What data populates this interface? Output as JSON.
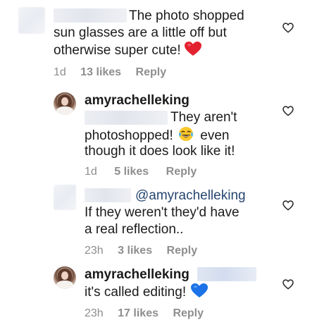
{
  "comments": [
    {
      "text_line1": "The photo shopped",
      "text_line2": "sun glasses are a little off but",
      "text_line3": "otherwise super cute!",
      "emoji": "red-heart-emoji",
      "time": "1d",
      "likes": "13 likes",
      "reply": "Reply"
    },
    {
      "username": "amyrachelleking",
      "text_line1": "They aren't",
      "text_line2a": "photoshopped!",
      "emoji": "tears-of-joy-emoji",
      "text_line2b": "even",
      "text_line3": "though it does look like it!",
      "time": "1d",
      "likes": "5 likes",
      "reply": "Reply"
    },
    {
      "mention": "@amyrachelleking",
      "text_line1": "If they weren't they'd have",
      "text_line2": "a real reflection..",
      "time": "23h",
      "likes": "3 likes",
      "reply": "Reply"
    },
    {
      "username": "amyrachelleking",
      "text_line1": "it's called editing!",
      "emoji": "blue-heart-emoji",
      "time": "23h",
      "likes": "17 likes",
      "reply": "Reply"
    }
  ],
  "icons": {
    "like": "heart-outline-icon"
  },
  "colors": {
    "meta": "#8e8e8e",
    "mention": "#26466f",
    "text": "#1b1b1b"
  }
}
